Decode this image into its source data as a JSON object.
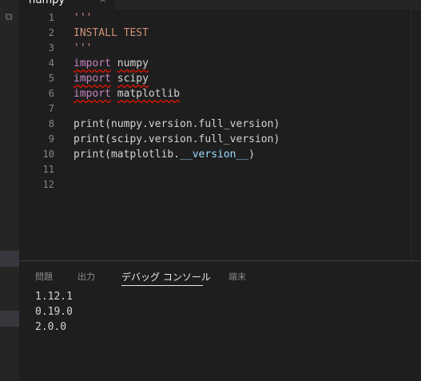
{
  "tab": {
    "label": "numpy",
    "close": "×"
  },
  "editor": {
    "lines": [
      {
        "num": "1",
        "text": "'''"
      },
      {
        "num": "2",
        "text": "INSTALL TEST"
      },
      {
        "num": "3",
        "text": "'''"
      },
      {
        "num": "4",
        "kw": "import",
        "mod": "numpy"
      },
      {
        "num": "5",
        "kw": "import",
        "mod": "scipy"
      },
      {
        "num": "6",
        "kw": "import",
        "mod": "matplotlib"
      },
      {
        "num": "7"
      },
      {
        "num": "8",
        "text": "print(numpy.version.full_version)"
      },
      {
        "num": "9",
        "text": "print(scipy.version.full_version)"
      },
      {
        "num": "10",
        "pre": "print(matplotlib.",
        "dunder": "__version__",
        "post": ")"
      },
      {
        "num": "11"
      },
      {
        "num": "12"
      }
    ]
  },
  "panel": {
    "tabs": [
      "問題",
      "出力",
      "デバッグ コンソール",
      "端末"
    ],
    "output": [
      "1.12.1",
      "0.19.0",
      "2.0.0"
    ]
  },
  "colors": {
    "string": "#ce9178",
    "keyword": "#c586c0",
    "error_squiggle": "#e51400"
  },
  "icons": {
    "explorer": "copy-icon"
  }
}
